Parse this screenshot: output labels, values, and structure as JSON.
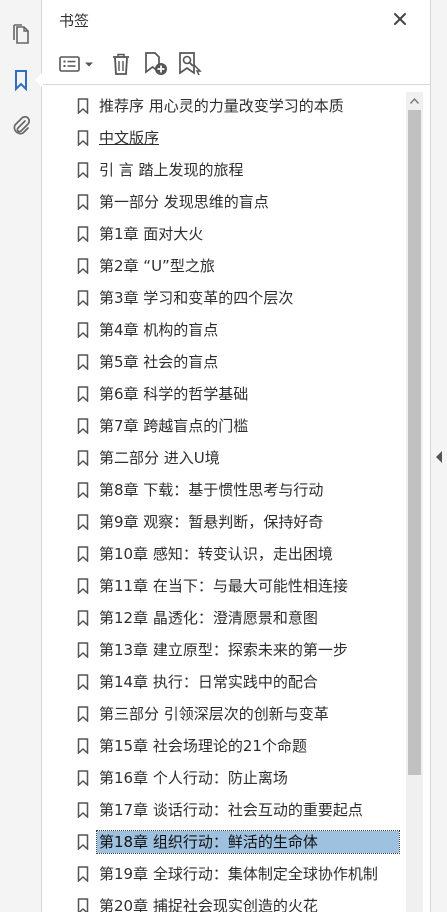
{
  "panel": {
    "title": "书签",
    "close_icon": "close-icon"
  },
  "rail": {
    "items": [
      {
        "name": "page-thumbnails",
        "icon": "pages-icon"
      },
      {
        "name": "bookmarks",
        "icon": "bookmark-icon",
        "active": true
      },
      {
        "name": "attachments",
        "icon": "paperclip-icon"
      }
    ]
  },
  "toolbar": {
    "tools": [
      {
        "name": "options",
        "icon": "list-options-icon"
      },
      {
        "name": "delete-bookmark",
        "icon": "trash-icon"
      },
      {
        "name": "new-bookmark",
        "icon": "new-bookmark-icon"
      },
      {
        "name": "find-current-bookmark",
        "icon": "find-bookmark-icon"
      }
    ]
  },
  "bookmarks": [
    {
      "label": "推荐序 用心灵的力量改变学习的本质"
    },
    {
      "label": "中文版序",
      "underline": true
    },
    {
      "label": "引 言 踏上发现的旅程"
    },
    {
      "label": "第一部分 发现思维的盲点"
    },
    {
      "label": "第1章 面对大火"
    },
    {
      "label": "第2章 “U”型之旅"
    },
    {
      "label": "第3章 学习和变革的四个层次"
    },
    {
      "label": "第4章 机构的盲点"
    },
    {
      "label": "第5章 社会的盲点"
    },
    {
      "label": "第6章 科学的哲学基础"
    },
    {
      "label": "第7章 跨越盲点的门槛"
    },
    {
      "label": "第二部分 进入U境"
    },
    {
      "label": "第8章 下载：基于惯性思考与行动"
    },
    {
      "label": "第9章 观察：暂悬判断，保持好奇"
    },
    {
      "label": "第10章 感知：转变认识，走出困境"
    },
    {
      "label": "第11章 在当下：与最大可能性相连接"
    },
    {
      "label": "第12章 晶透化：澄清愿景和意图"
    },
    {
      "label": "第13章 建立原型：探索未来的第一步"
    },
    {
      "label": "第14章 执行：日常实践中的配合"
    },
    {
      "label": "第三部分 引领深层次的创新与变革"
    },
    {
      "label": "第15章 社会场理论的21个命题"
    },
    {
      "label": "第16章 个人行动：防止离场"
    },
    {
      "label": "第17章 谈话行动：社会互动的重要起点"
    },
    {
      "label": "第18章 组织行动：鲜活的生命体",
      "selected": true
    },
    {
      "label": "第19章 全球行动：集体制定全球协作机制"
    },
    {
      "label": "第20章 捕捉社会现实创造的火花"
    }
  ],
  "colors": {
    "selection": "#9ec1df",
    "rail_active": "#2f6fbf"
  }
}
